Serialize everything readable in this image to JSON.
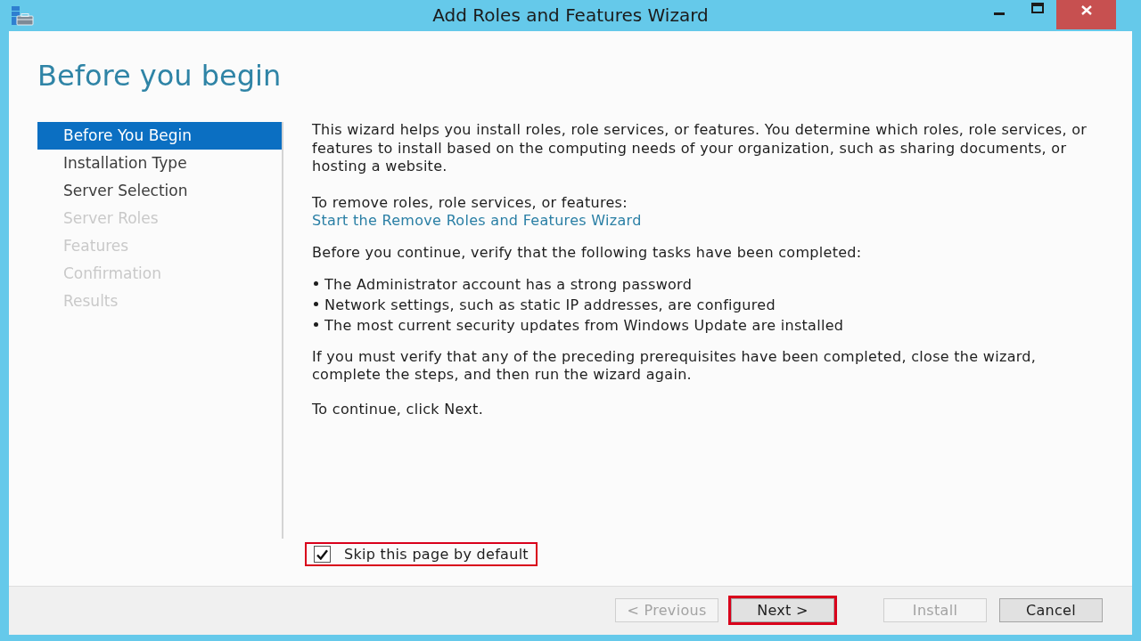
{
  "window": {
    "title": "Add Roles and Features Wizard"
  },
  "page_title": "Before you begin",
  "steps": [
    {
      "label": "Before You Begin",
      "selected": true,
      "disabled": false
    },
    {
      "label": "Installation Type",
      "selected": false,
      "disabled": false
    },
    {
      "label": "Server Selection",
      "selected": false,
      "disabled": false
    },
    {
      "label": "Server Roles",
      "selected": false,
      "disabled": true
    },
    {
      "label": "Features",
      "selected": false,
      "disabled": true
    },
    {
      "label": "Confirmation",
      "selected": false,
      "disabled": true
    },
    {
      "label": "Results",
      "selected": false,
      "disabled": true
    }
  ],
  "content": {
    "intro": "This wizard helps you install roles, role services, or features. You determine which roles, role services, or features to install based on the computing needs of your organization, such as sharing documents, or hosting a website.",
    "remove_label": "To remove roles, role services, or features:",
    "remove_link": "Start the Remove Roles and Features Wizard",
    "prerequisites_intro": "Before you continue, verify that the following tasks have been completed:",
    "prerequisites": [
      "The Administrator account has a strong password",
      "Network settings, such as static IP addresses, are configured",
      "The most current security updates from Windows Update are installed"
    ],
    "verify_note": "If you must verify that any of the preceding prerequisites have been completed, close the wizard, complete the steps, and then run the wizard again.",
    "continue_note": "To continue, click Next."
  },
  "skip_checkbox": {
    "label": "Skip this page by default",
    "checked": true,
    "highlighted": true
  },
  "nav_buttons": [
    {
      "label": "< Previous",
      "disabled": true,
      "highlighted": false
    },
    {
      "label": "Next >",
      "disabled": false,
      "highlighted": true
    }
  ],
  "action_buttons": [
    {
      "label": "Install",
      "disabled": true,
      "highlighted": false
    },
    {
      "label": "Cancel",
      "disabled": false,
      "highlighted": false
    }
  ]
}
